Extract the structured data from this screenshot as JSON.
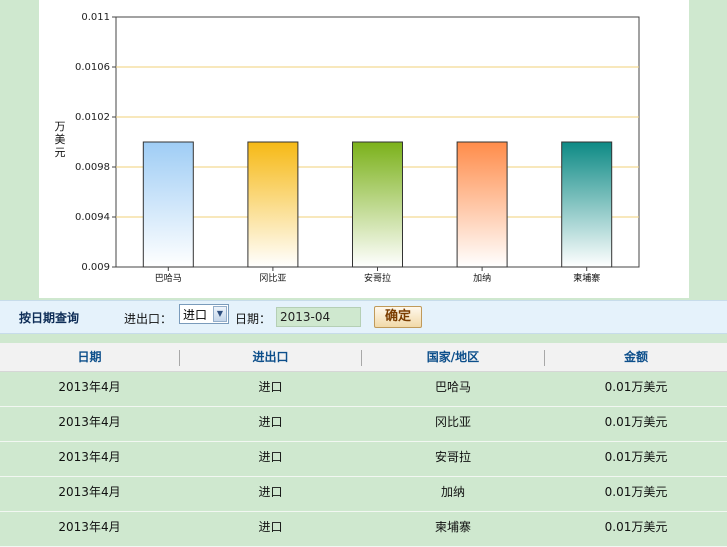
{
  "chart_data": {
    "type": "bar",
    "ylabel": "万美元",
    "ylim": [
      0.009,
      0.011
    ],
    "yticks": [
      "0.009",
      "0.0094",
      "0.0098",
      "0.0102",
      "0.0106",
      "0.011"
    ],
    "categories": [
      "巴哈马",
      "冈比亚",
      "安哥拉",
      "加纳",
      "柬埔寨"
    ],
    "values": [
      0.01,
      0.01,
      0.01,
      0.01,
      0.01
    ],
    "colors": [
      "#9fcdf5",
      "#f6b915",
      "#7bb11a",
      "#ff8c4a",
      "#0d8a85"
    ],
    "grid": true
  },
  "filter": {
    "title": "按日期查询",
    "io_label": "进出口：",
    "io_value": "进口",
    "date_label": "日期：",
    "date_value": "2013-04",
    "confirm_label": "确定"
  },
  "table": {
    "headers": [
      "日期",
      "进出口",
      "国家/地区",
      "金额"
    ],
    "rows": [
      [
        "2013年4月",
        "进口",
        "巴哈马",
        "0.01万美元"
      ],
      [
        "2013年4月",
        "进口",
        "冈比亚",
        "0.01万美元"
      ],
      [
        "2013年4月",
        "进口",
        "安哥拉",
        "0.01万美元"
      ],
      [
        "2013年4月",
        "进口",
        "加纳",
        "0.01万美元"
      ],
      [
        "2013年4月",
        "进口",
        "柬埔寨",
        "0.01万美元"
      ]
    ]
  }
}
